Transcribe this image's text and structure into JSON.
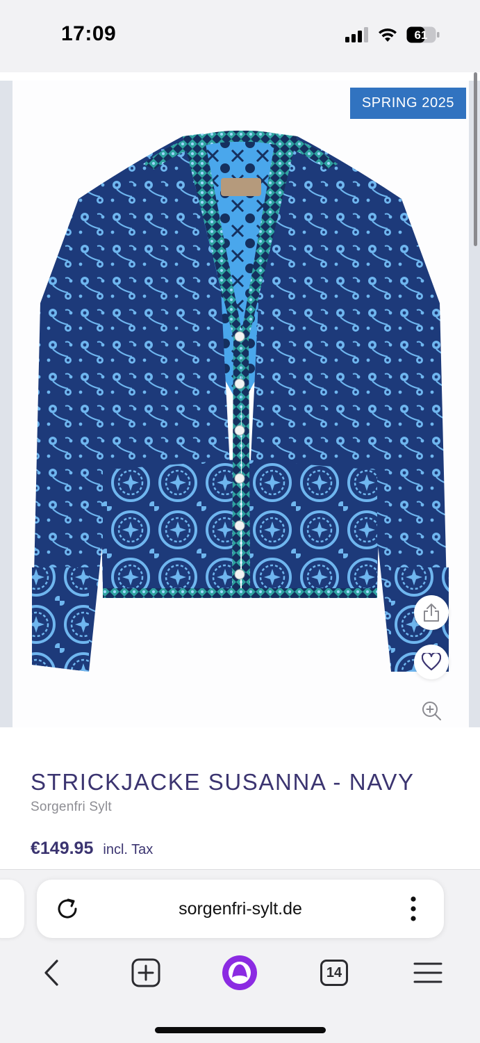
{
  "status_bar": {
    "time": "17:09",
    "battery": "61",
    "icons": [
      "cellular-signal-icon",
      "wifi-icon",
      "battery-icon"
    ]
  },
  "product": {
    "badge": "SPRING 2025",
    "title": "STRICKJACKE SUSANNA - NAVY",
    "brand": "Sorgenfri Sylt",
    "price": "€149.95",
    "tax_note": "incl. Tax",
    "image_description_icon": "cardigan-product-photo",
    "actions": [
      "share-icon",
      "heart-icon",
      "zoom-in-icon"
    ]
  },
  "browser": {
    "url": "sorgenfri-sylt.de",
    "tab_count": "14",
    "nav_icons": [
      "back-arrow-icon",
      "new-tab-icon",
      "assistant-icon",
      "tabs-icon",
      "hamburger-menu-icon"
    ]
  },
  "colors": {
    "accent": "#3b3470",
    "badge": "#3173c0",
    "assistant": "#8b2be2",
    "garment_navy": "#1d3a7a",
    "garment_light": "#6fb6ef"
  }
}
